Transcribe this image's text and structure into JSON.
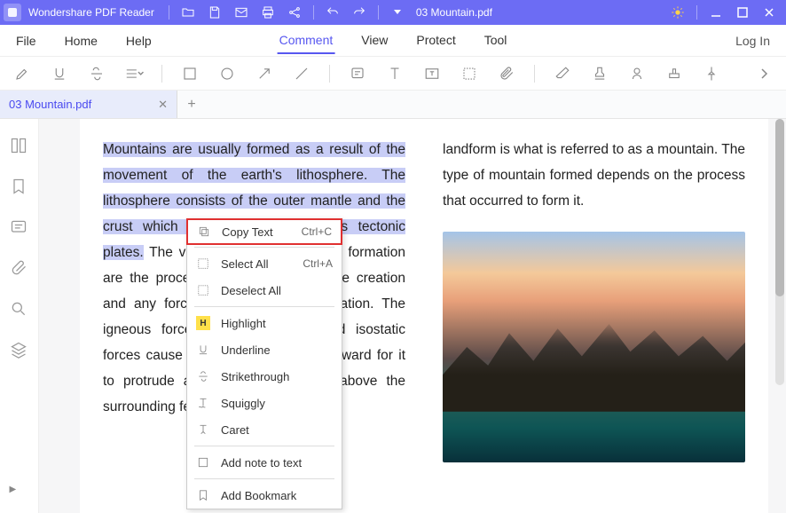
{
  "titlebar": {
    "app_name": "Wondershare PDF Reader",
    "doc_name": "03 Mountain.pdf"
  },
  "menubar": {
    "left": [
      "File",
      "Home",
      "Help"
    ],
    "center": [
      "Comment",
      "View",
      "Protect",
      "Tool"
    ],
    "active": "Comment",
    "login": "Log In"
  },
  "tabs": {
    "name": "03 Mountain.pdf"
  },
  "document": {
    "col1_highlighted": "Mountains are usually formed as a result of the movement of the earth's lithosphere. The lithosphere consists of the outer mantle and the crust which are also referred to as tectonic plates.",
    "col1_rest": " The various types of mountain formation are the process and activities that the creation and any forces acting on their formation. The igneous forces, tectonic forces, and isostatic forces cause earth's crust to move upward for it to protrude at that particular point above the surrounding features. The resultant",
    "col2_text": "landform is what is referred to as a mountain. The type of mountain formed depends on the process that occurred to form it."
  },
  "context_menu": {
    "copy_text": "Copy Text",
    "copy_sc": "Ctrl+C",
    "select_all": "Select All",
    "select_sc": "Ctrl+A",
    "deselect": "Deselect All",
    "highlight": "Highlight",
    "underline": "Underline",
    "strike": "Strikethrough",
    "squiggly": "Squiggly",
    "caret": "Caret",
    "note": "Add note to text",
    "bookmark": "Add Bookmark"
  }
}
